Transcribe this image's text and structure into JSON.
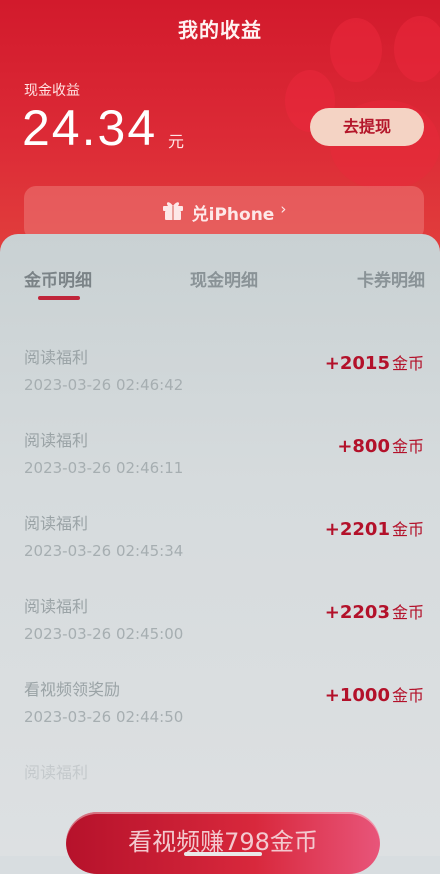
{
  "header": {
    "title": "我的收益",
    "cash_label": "现金收益",
    "cash_amount": "24.34",
    "cash_unit": "元",
    "withdraw_label": "去提现",
    "exchange_label": "兑iPhone",
    "exchange_chevron": "›"
  },
  "tabs": [
    {
      "label": "金币明细",
      "active": true
    },
    {
      "label": "现金明细",
      "active": false
    },
    {
      "label": "卡券明细",
      "active": false
    }
  ],
  "records": [
    {
      "name": "阅读福利",
      "time": "2023-03-26 02:46:42",
      "amount": "+2015",
      "unit": "金币"
    },
    {
      "name": "阅读福利",
      "time": "2023-03-26 02:46:11",
      "amount": "+800",
      "unit": "金币"
    },
    {
      "name": "阅读福利",
      "time": "2023-03-26 02:45:34",
      "amount": "+2201",
      "unit": "金币"
    },
    {
      "name": "阅读福利",
      "time": "2023-03-26 02:45:00",
      "amount": "+2203",
      "unit": "金币"
    },
    {
      "name": "看视频领奖励",
      "time": "2023-03-26 02:44:50",
      "amount": "+1000",
      "unit": "金币"
    }
  ],
  "partial_record": {
    "name": "阅读福利"
  },
  "cta_label": "看视频赚798金币",
  "colors": {
    "accent": "#c0253a",
    "header": "#d21a2c"
  }
}
